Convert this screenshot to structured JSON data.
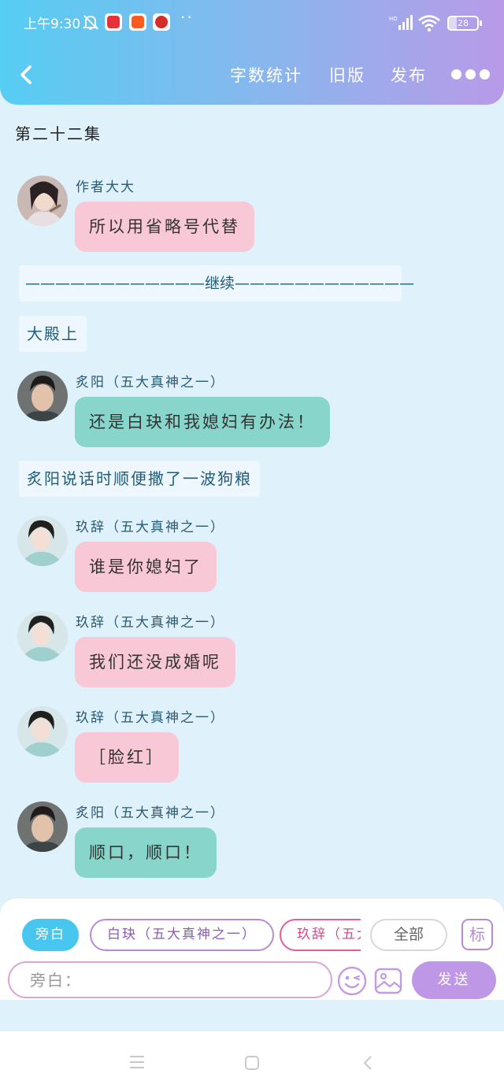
{
  "status_bar": {
    "time": "上午9:30",
    "dots": "··",
    "battery": "28",
    "battery_fraction": 0.28,
    "icons": [
      "muted-bell-icon",
      "video-app-icon",
      "kuaishou-app-icon",
      "news-app-icon",
      "hd-signal-icon",
      "wifi-icon",
      "battery-icon"
    ]
  },
  "nav": {
    "back_icon": "chevron-left-icon",
    "word_count": "字数统计",
    "old_version": "旧版",
    "publish": "发布",
    "more_icon": "more-dots-icon"
  },
  "chat": {
    "episode_title": "第二十二集",
    "messages": [
      {
        "speaker": "作者大大",
        "text": "所以用省略号代替",
        "style": "pink"
      },
      {
        "speaker": "炙阳（五大真神之一）",
        "text": "还是白玦和我媳妇有办法！",
        "style": "teal"
      },
      {
        "speaker": "玖辞（五大真神之一）",
        "text": "谁是你媳妇了",
        "style": "pink"
      },
      {
        "speaker": "玖辞（五大真神之一）",
        "text": "我们还没成婚呢",
        "style": "pink"
      },
      {
        "speaker": "玖辞（五大真神之一）",
        "text": "［脸红］",
        "style": "pink"
      },
      {
        "speaker": "炙阳（五大真神之一）",
        "text": "顺口，顺口！",
        "style": "teal"
      }
    ],
    "narrations": [
      "————————————继续————————————",
      "大殿上",
      "炙阳说话时顺便撒了一波狗粮"
    ]
  },
  "composer": {
    "chips": [
      "旁白",
      "白玦（五大真神之一）",
      "玖辞（五大真神之一）"
    ],
    "all_label": "全部",
    "mark_label": "标",
    "input_placeholder": "旁白：",
    "send_label": "发送",
    "emoji_icon": "emoji-wink-icon",
    "image_icon": "image-icon"
  },
  "system_nav": {
    "icons": [
      "menu-icon",
      "home-icon",
      "back-icon"
    ]
  },
  "colors": {
    "header_gradient_start": "#56cdf2",
    "header_gradient_end": "#b99ae8",
    "chat_background": "#dff1fb",
    "pink_bubble": "#f9c8d6",
    "teal_bubble": "#88d6cb",
    "active_chip": "#47c6ef",
    "send_button": "#be98e6"
  }
}
